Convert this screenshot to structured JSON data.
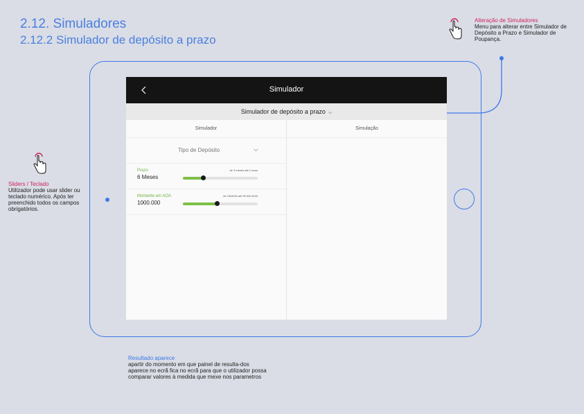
{
  "page": {
    "title": "2.12. Simuladores",
    "subtitle": "2.12.2 Simulador de depósito a prazo"
  },
  "annotations": {
    "top": {
      "heading": "Alteração de Simuladores",
      "body": "Menu para alterar entre Simulador de Depósito a Prazo e Simulador de Poupança."
    },
    "left": {
      "heading": "Sliders  / Teclado",
      "body": "Utilizador pode usar slider ou teclado numérico. Após ter preenchido todos os campos obrigatórios."
    },
    "bottom": {
      "heading": "Resultado aparece",
      "body": "apartir do momento em que painel de resulta-dos aparece no ecrã fica  no ecrã para que o utilizador possa comparar valores à medida que mexe nos parametros"
    }
  },
  "app": {
    "header_title": "Simulador",
    "selector_label": "Simulador de depósito a prazo",
    "columns": [
      "Simulador",
      "Simulação"
    ],
    "deposit_type_placeholder": "Tipo de Depósito",
    "fields": [
      {
        "label": "Prazo",
        "value": "6 Meses",
        "range_text": "de 3 meses até 2 anos",
        "slider_fraction": 0.27
      },
      {
        "label": "Montante em AOA",
        "value": "1000.000",
        "range_text": "de 100AOA até 90.000 AOA",
        "slider_fraction": 0.45
      }
    ]
  },
  "colors": {
    "accent_blue": "#3d78e6",
    "annotation_pink": "#d0245e",
    "slider_green": "#7dbf47",
    "header_dark": "#141414"
  },
  "icons": [
    "pointer-hand-icon",
    "back-arrow-icon",
    "chevron-down-icon"
  ]
}
